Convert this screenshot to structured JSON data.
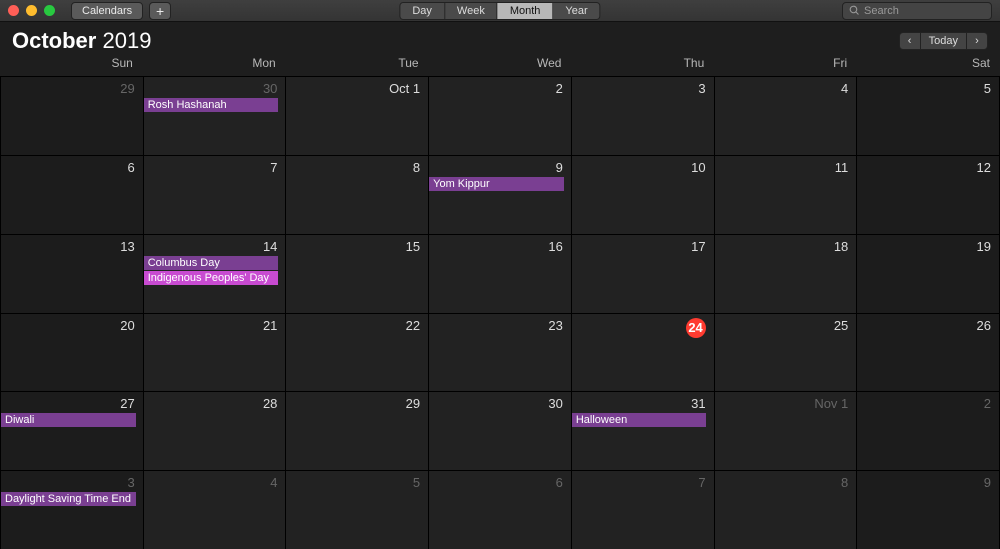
{
  "toolbar": {
    "calendars_label": "Calendars",
    "add_label": "+",
    "view_tabs": [
      "Day",
      "Week",
      "Month",
      "Year"
    ],
    "active_view": "Month",
    "search_placeholder": "Search"
  },
  "header": {
    "month": "October",
    "year": "2019",
    "prev": "‹",
    "today": "Today",
    "next": "›"
  },
  "weekdays": [
    "Sun",
    "Mon",
    "Tue",
    "Wed",
    "Thu",
    "Fri",
    "Sat"
  ],
  "cells": [
    {
      "label": "29",
      "dim": true,
      "weekend": true
    },
    {
      "label": "30",
      "dim": true,
      "events": [
        {
          "title": "Rosh Hashanah",
          "color": "purple"
        }
      ]
    },
    {
      "label": "Oct 1"
    },
    {
      "label": "2"
    },
    {
      "label": "3"
    },
    {
      "label": "4"
    },
    {
      "label": "5",
      "weekend": true
    },
    {
      "label": "6",
      "weekend": true
    },
    {
      "label": "7"
    },
    {
      "label": "8"
    },
    {
      "label": "9",
      "events": [
        {
          "title": "Yom Kippur",
          "color": "purple"
        }
      ]
    },
    {
      "label": "10"
    },
    {
      "label": "11"
    },
    {
      "label": "12",
      "weekend": true
    },
    {
      "label": "13",
      "weekend": true
    },
    {
      "label": "14",
      "events": [
        {
          "title": "Columbus Day",
          "color": "purple"
        },
        {
          "title": "Indigenous Peoples' Day",
          "color": "magenta"
        }
      ]
    },
    {
      "label": "15"
    },
    {
      "label": "16"
    },
    {
      "label": "17"
    },
    {
      "label": "18"
    },
    {
      "label": "19",
      "weekend": true
    },
    {
      "label": "20",
      "weekend": true
    },
    {
      "label": "21"
    },
    {
      "label": "22"
    },
    {
      "label": "23"
    },
    {
      "label": "24",
      "today": true
    },
    {
      "label": "25"
    },
    {
      "label": "26",
      "weekend": true
    },
    {
      "label": "27",
      "weekend": true,
      "events": [
        {
          "title": "Diwali",
          "color": "purple"
        }
      ]
    },
    {
      "label": "28"
    },
    {
      "label": "29"
    },
    {
      "label": "30"
    },
    {
      "label": "31",
      "events": [
        {
          "title": "Halloween",
          "color": "purple"
        }
      ]
    },
    {
      "label": "Nov 1",
      "dim": true
    },
    {
      "label": "2",
      "dim": true,
      "weekend": true
    },
    {
      "label": "3",
      "dim": true,
      "weekend": true,
      "events": [
        {
          "title": "Daylight Saving Time End",
          "color": "purple"
        }
      ]
    },
    {
      "label": "4",
      "dim": true
    },
    {
      "label": "5",
      "dim": true
    },
    {
      "label": "6",
      "dim": true
    },
    {
      "label": "7",
      "dim": true
    },
    {
      "label": "8",
      "dim": true
    },
    {
      "label": "9",
      "dim": true,
      "weekend": true
    }
  ]
}
